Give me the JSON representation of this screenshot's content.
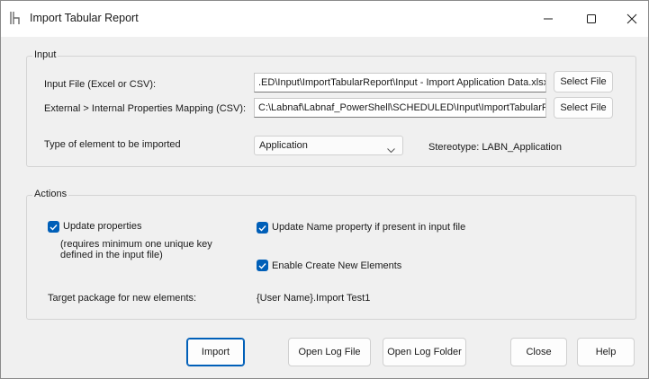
{
  "window": {
    "title": "Import Tabular Report",
    "minimize_glyph": "—",
    "maximize_glyph": "☐",
    "close_glyph": "✕"
  },
  "input_group": {
    "title": "Input",
    "input_file_label": "Input File (Excel or CSV):",
    "input_file_value": ".ED\\Input\\ImportTabularReport\\Input - Import Application Data.xlsx",
    "input_file_button": "Select File",
    "mapping_label": "External > Internal Properties Mapping (CSV):",
    "mapping_value": "C:\\Labnaf\\Labnaf_PowerShell\\SCHEDULED\\Input\\ImportTabularF",
    "mapping_button": "Select File",
    "element_type_label": "Type of element to be imported",
    "element_type_value": "Application",
    "stereotype_text": "Stereotype: LABN_Application"
  },
  "actions_group": {
    "title": "Actions",
    "update_properties": {
      "label": "Update properties",
      "checked": true
    },
    "update_properties_note_line1": "(requires minimum one unique key",
    "update_properties_note_line2": "defined in the input file)",
    "update_name": {
      "label": "Update Name property if present in input file",
      "checked": true
    },
    "enable_create": {
      "label": "Enable Create New Elements",
      "checked": true
    },
    "target_package_label": "Target package for new elements:",
    "target_package_value": "{User Name}.Import Test1"
  },
  "buttons": {
    "import": "Import",
    "open_log_file": "Open Log File",
    "open_log_folder": "Open Log Folder",
    "close": "Close",
    "help": "Help"
  },
  "colors": {
    "accent": "#005fb8",
    "window_bg": "#f0f0f0",
    "titlebar_bg": "#ffffff"
  }
}
